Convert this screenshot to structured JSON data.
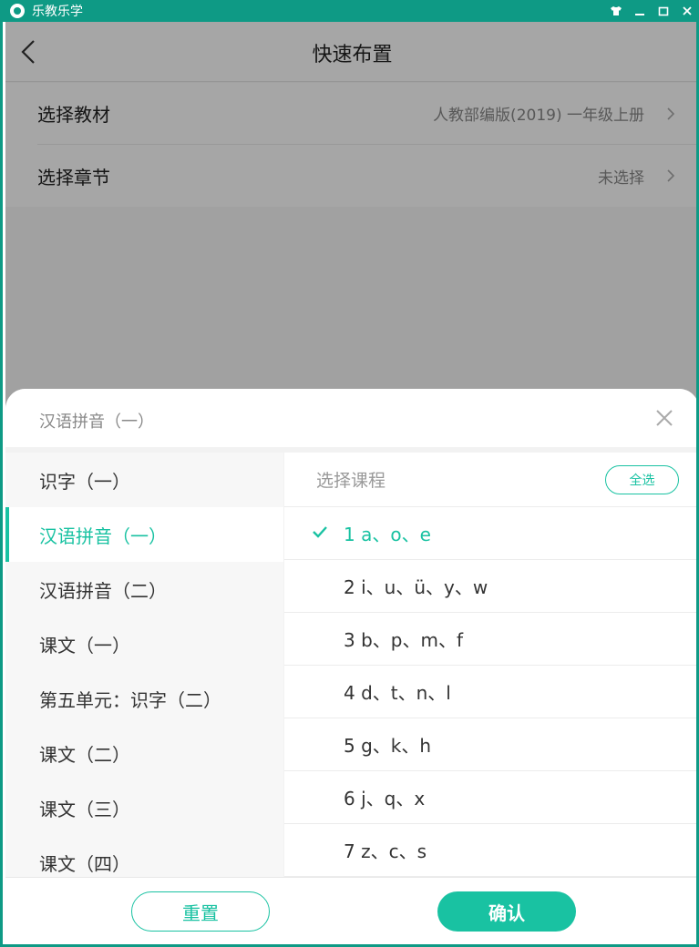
{
  "app": {
    "title": "乐教乐学"
  },
  "page": {
    "title": "快速布置"
  },
  "settings": [
    {
      "label": "选择教材",
      "value": "人教部编版(2019) 一年级上册"
    },
    {
      "label": "选择章节",
      "value": "未选择"
    }
  ],
  "sheet": {
    "title": "汉语拼音（一）",
    "units": [
      "识字（一）",
      "汉语拼音（一）",
      "汉语拼音（二）",
      "课文（一）",
      "第五单元：识字（二）",
      "课文（二）",
      "课文（三）",
      "课文（四）"
    ],
    "active_unit_index": 1,
    "lessons_title": "选择课程",
    "select_all_label": "全选",
    "lessons": [
      "1 a、o、e",
      "2 i、u、ü、y、w",
      "3 b、p、m、f",
      "4 d、t、n、l",
      "5 g、k、h",
      "6 j、q、x",
      "7 z、c、s"
    ],
    "checked_lesson_index": 0,
    "reset_label": "重置",
    "confirm_label": "确认"
  },
  "colors": {
    "brand": "#0e9a85",
    "accent": "#19c2a2"
  },
  "icons": {
    "back": "chevron-left-icon",
    "chevron": "chevron-right-icon",
    "close": "close-icon",
    "check": "checkmark-icon"
  }
}
